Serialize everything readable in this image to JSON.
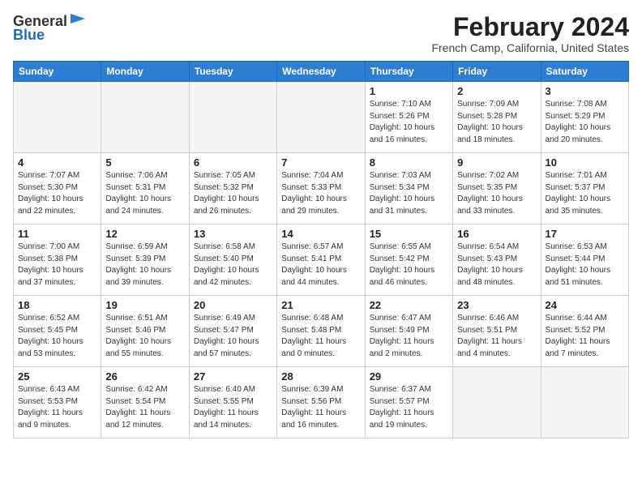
{
  "header": {
    "logo": {
      "line1": "General",
      "line2": "Blue"
    },
    "title": "February 2024",
    "location": "French Camp, California, United States"
  },
  "weekdays": [
    "Sunday",
    "Monday",
    "Tuesday",
    "Wednesday",
    "Thursday",
    "Friday",
    "Saturday"
  ],
  "weeks": [
    [
      {
        "day": "",
        "info": ""
      },
      {
        "day": "",
        "info": ""
      },
      {
        "day": "",
        "info": ""
      },
      {
        "day": "",
        "info": ""
      },
      {
        "day": "1",
        "info": "Sunrise: 7:10 AM\nSunset: 5:26 PM\nDaylight: 10 hours\nand 16 minutes."
      },
      {
        "day": "2",
        "info": "Sunrise: 7:09 AM\nSunset: 5:28 PM\nDaylight: 10 hours\nand 18 minutes."
      },
      {
        "day": "3",
        "info": "Sunrise: 7:08 AM\nSunset: 5:29 PM\nDaylight: 10 hours\nand 20 minutes."
      }
    ],
    [
      {
        "day": "4",
        "info": "Sunrise: 7:07 AM\nSunset: 5:30 PM\nDaylight: 10 hours\nand 22 minutes."
      },
      {
        "day": "5",
        "info": "Sunrise: 7:06 AM\nSunset: 5:31 PM\nDaylight: 10 hours\nand 24 minutes."
      },
      {
        "day": "6",
        "info": "Sunrise: 7:05 AM\nSunset: 5:32 PM\nDaylight: 10 hours\nand 26 minutes."
      },
      {
        "day": "7",
        "info": "Sunrise: 7:04 AM\nSunset: 5:33 PM\nDaylight: 10 hours\nand 29 minutes."
      },
      {
        "day": "8",
        "info": "Sunrise: 7:03 AM\nSunset: 5:34 PM\nDaylight: 10 hours\nand 31 minutes."
      },
      {
        "day": "9",
        "info": "Sunrise: 7:02 AM\nSunset: 5:35 PM\nDaylight: 10 hours\nand 33 minutes."
      },
      {
        "day": "10",
        "info": "Sunrise: 7:01 AM\nSunset: 5:37 PM\nDaylight: 10 hours\nand 35 minutes."
      }
    ],
    [
      {
        "day": "11",
        "info": "Sunrise: 7:00 AM\nSunset: 5:38 PM\nDaylight: 10 hours\nand 37 minutes."
      },
      {
        "day": "12",
        "info": "Sunrise: 6:59 AM\nSunset: 5:39 PM\nDaylight: 10 hours\nand 39 minutes."
      },
      {
        "day": "13",
        "info": "Sunrise: 6:58 AM\nSunset: 5:40 PM\nDaylight: 10 hours\nand 42 minutes."
      },
      {
        "day": "14",
        "info": "Sunrise: 6:57 AM\nSunset: 5:41 PM\nDaylight: 10 hours\nand 44 minutes."
      },
      {
        "day": "15",
        "info": "Sunrise: 6:55 AM\nSunset: 5:42 PM\nDaylight: 10 hours\nand 46 minutes."
      },
      {
        "day": "16",
        "info": "Sunrise: 6:54 AM\nSunset: 5:43 PM\nDaylight: 10 hours\nand 48 minutes."
      },
      {
        "day": "17",
        "info": "Sunrise: 6:53 AM\nSunset: 5:44 PM\nDaylight: 10 hours\nand 51 minutes."
      }
    ],
    [
      {
        "day": "18",
        "info": "Sunrise: 6:52 AM\nSunset: 5:45 PM\nDaylight: 10 hours\nand 53 minutes."
      },
      {
        "day": "19",
        "info": "Sunrise: 6:51 AM\nSunset: 5:46 PM\nDaylight: 10 hours\nand 55 minutes."
      },
      {
        "day": "20",
        "info": "Sunrise: 6:49 AM\nSunset: 5:47 PM\nDaylight: 10 hours\nand 57 minutes."
      },
      {
        "day": "21",
        "info": "Sunrise: 6:48 AM\nSunset: 5:48 PM\nDaylight: 11 hours\nand 0 minutes."
      },
      {
        "day": "22",
        "info": "Sunrise: 6:47 AM\nSunset: 5:49 PM\nDaylight: 11 hours\nand 2 minutes."
      },
      {
        "day": "23",
        "info": "Sunrise: 6:46 AM\nSunset: 5:51 PM\nDaylight: 11 hours\nand 4 minutes."
      },
      {
        "day": "24",
        "info": "Sunrise: 6:44 AM\nSunset: 5:52 PM\nDaylight: 11 hours\nand 7 minutes."
      }
    ],
    [
      {
        "day": "25",
        "info": "Sunrise: 6:43 AM\nSunset: 5:53 PM\nDaylight: 11 hours\nand 9 minutes."
      },
      {
        "day": "26",
        "info": "Sunrise: 6:42 AM\nSunset: 5:54 PM\nDaylight: 11 hours\nand 12 minutes."
      },
      {
        "day": "27",
        "info": "Sunrise: 6:40 AM\nSunset: 5:55 PM\nDaylight: 11 hours\nand 14 minutes."
      },
      {
        "day": "28",
        "info": "Sunrise: 6:39 AM\nSunset: 5:56 PM\nDaylight: 11 hours\nand 16 minutes."
      },
      {
        "day": "29",
        "info": "Sunrise: 6:37 AM\nSunset: 5:57 PM\nDaylight: 11 hours\nand 19 minutes."
      },
      {
        "day": "",
        "info": ""
      },
      {
        "day": "",
        "info": ""
      }
    ]
  ]
}
